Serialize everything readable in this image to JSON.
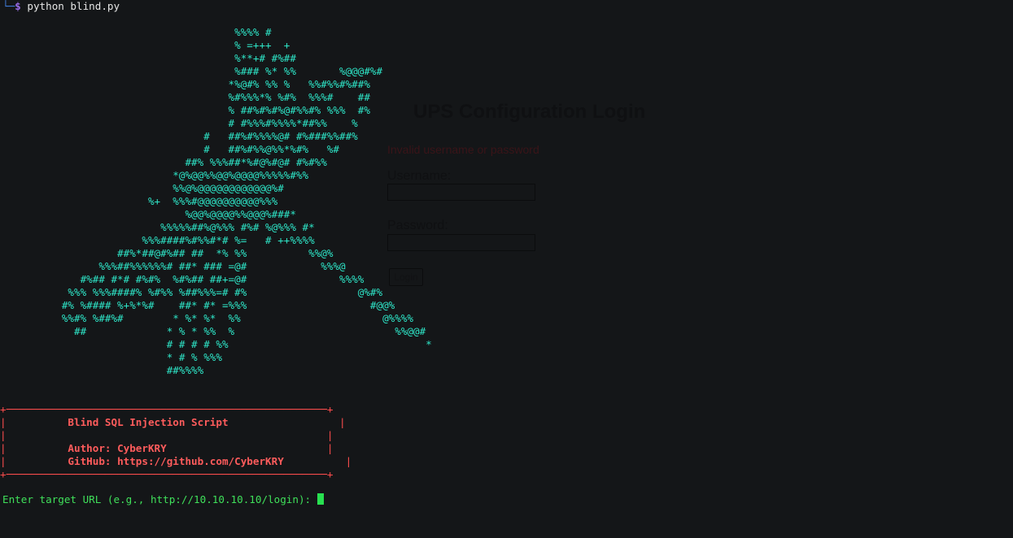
{
  "prompt": {
    "tree": "└─",
    "dollar": "$",
    "command": "python blind.py"
  },
  "ascii_art": [
    "                                      %%%% #",
    "                                      % =+++  +",
    "                                      %**+# #%##",
    "                                      %### %* %%       %@@@#%#",
    "                                     *%@#% %% %   %%#%%#%##%",
    "                                     %#%%%*% %#%  %%%#    ##",
    "                                     % ##%#%#%@#%%#% %%%  #%",
    "                                     # #%%%#%%%%*##%%    %",
    "                                 #   ##%#%%%%@# #%###%%##%",
    "                                 #   ##%#%%@%%*%#%   %#",
    "                              ##% %%%##*%#@%#@# #%#%%",
    "                            *@%@@%%@@%@@@@%%%%%#%%",
    "                            %%@%@@@@@@@@@@@@%#",
    "                        %+  %%%#@@@@@@@@@@%%%",
    "                              %@@%@@@@%%@@@%###*",
    "                          %%%%%##%@%%% #%# %@%%% #*",
    "                       %%%####%#%%#*# %=   # ++%%%%",
    "                   ##%*##@#%## ##  *% %%          %%@%",
    "                %%%##%%%%%%# ##* ### =@#            %%%@",
    "             #%## #*# #%#%  %#%## ##+=@#               %%%%",
    "           %%% %%%####% %#%% %##%%%=# #%                  @%#%",
    "          #% %#### %+%*%#    ##* #* =%%%                    #@@%",
    "          %%#% %##%#        * %* %*  %%                       @%%%%",
    "            ##             * % * %%  %                          %%@@#",
    "                           # # # # %%                                *",
    "                           * # % %%%",
    "                           ##%%%%"
  ],
  "banner": {
    "border_top": "+────────────────────────────────────────────────────+",
    "border_bottom": "+────────────────────────────────────────────────────+",
    "title": "Blind SQL Injection Script",
    "author": "Author: CyberKRY",
    "github": "GitHub: https://github.com/CyberKRY"
  },
  "input_prompt": "Enter target URL (e.g., http://10.10.10.10/login): ",
  "ghost_login": {
    "title": "UPS Configuration Login",
    "error": "Invalid username or password",
    "username_label": "Username:",
    "password_label": "Password:",
    "button_label": "Login"
  },
  "colors": {
    "background": "#141618",
    "ascii_art": "#2ee6c8",
    "banner": "#ff4d4d",
    "input_prompt": "#3fe05a"
  }
}
